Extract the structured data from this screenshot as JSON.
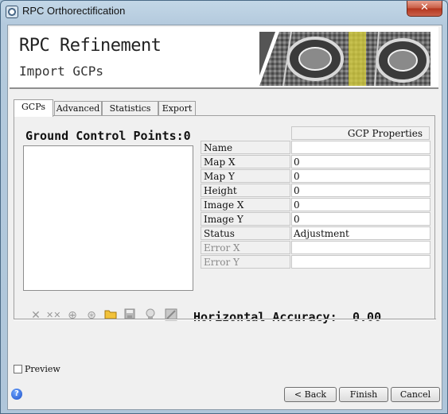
{
  "window": {
    "title": "RPC Orthorectification",
    "close_label": "✕"
  },
  "header": {
    "title": "RPC Refinement",
    "subtitle": "Import GCPs"
  },
  "tabs": [
    {
      "label": "GCPs",
      "active": true
    },
    {
      "label": "Advanced",
      "active": false
    },
    {
      "label": "Statistics",
      "active": false
    },
    {
      "label": "Export",
      "active": false
    }
  ],
  "gcp": {
    "heading": "Ground Control Points:0"
  },
  "properties": {
    "header": "GCP Properties",
    "rows": [
      {
        "name": "Name",
        "value": "",
        "enabled": true
      },
      {
        "name": "Map X",
        "value": "0",
        "enabled": true
      },
      {
        "name": "Map Y",
        "value": "0",
        "enabled": true
      },
      {
        "name": "Height",
        "value": "0",
        "enabled": true
      },
      {
        "name": "Image X",
        "value": "0",
        "enabled": true
      },
      {
        "name": "Image Y",
        "value": "0",
        "enabled": true
      },
      {
        "name": "Status",
        "value": "Adjustment",
        "enabled": true
      },
      {
        "name": "Error X",
        "value": "",
        "enabled": false
      },
      {
        "name": "Error Y",
        "value": "",
        "enabled": false
      }
    ]
  },
  "toolbar": {
    "icons": [
      "delete-icon",
      "delete-all-icon",
      "add-point-icon",
      "add-points-icon",
      "open-folder-icon",
      "save-icon",
      "view-icon",
      "table-icon"
    ]
  },
  "accuracy": {
    "label": "Horizontal Accuracy:",
    "value": "0.00"
  },
  "preview": {
    "label": "Preview",
    "checked": false
  },
  "buttons": {
    "back": "< Back",
    "finish": "Finish",
    "cancel": "Cancel"
  },
  "colors": {
    "accent": "#1d4fc8",
    "banner_highlight": "#d9d23a"
  }
}
